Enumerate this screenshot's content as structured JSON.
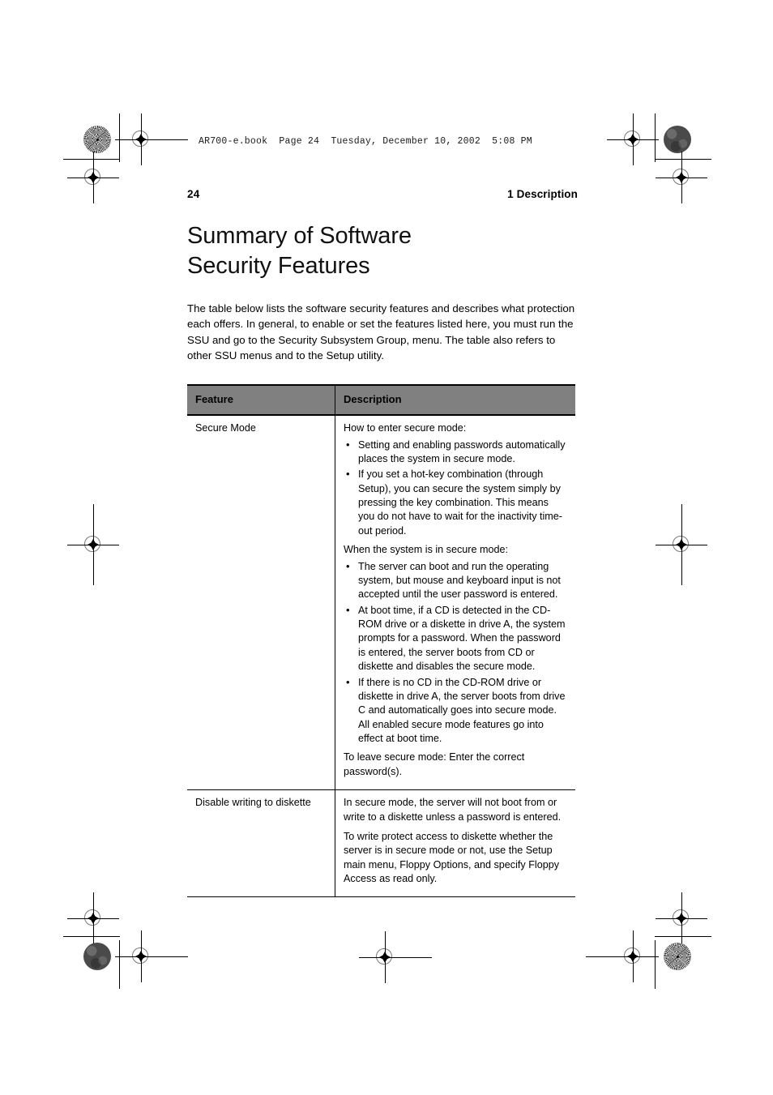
{
  "filestamp": "AR700-e.book  Page 24  Tuesday, December 10, 2002  5:08 PM",
  "page_header": {
    "folio": "24",
    "section": "1 Description"
  },
  "title": {
    "line1": "Summary of Software",
    "line2": "Security Features"
  },
  "intro": "The table below lists the software security features and describes what protection each offers. In general, to enable or set the features listed here, you must run the SSU and go to the Security Subsystem Group, menu. The table also refers to other SSU menus and to the Setup utility.",
  "table": {
    "headers": {
      "feature": "Feature",
      "description": "Description"
    },
    "rows": [
      {
        "feature": "Secure Mode",
        "blocks": [
          {
            "kind": "para",
            "text": "How to enter secure mode:"
          },
          {
            "kind": "list",
            "items": [
              "Setting and enabling passwords automatically places the system in secure mode.",
              "If you set a hot-key combination (through Setup), you can secure the system simply by pressing the key combination. This means you do not have to wait for the inactivity time-out period."
            ]
          },
          {
            "kind": "para",
            "text": "When the system is in secure mode:"
          },
          {
            "kind": "list",
            "items": [
              "The server can boot and run the operating system, but mouse and keyboard input is not accepted until the user password is entered.",
              "At boot time, if a CD is detected in the CD-ROM drive or a diskette in drive A, the system prompts for a password. When the password is entered, the server boots from CD or diskette and disables the secure mode.",
              "If there is no CD in the CD-ROM drive or diskette in drive A, the server boots from drive C and automatically goes into secure mode. All enabled secure mode features go into effect at boot time."
            ]
          },
          {
            "kind": "para",
            "text": "To leave secure mode: Enter the correct password(s)."
          }
        ]
      },
      {
        "feature": "Disable writing to diskette",
        "blocks": [
          {
            "kind": "para",
            "text": "In secure mode, the server will not boot from or write to a diskette unless a password is entered."
          },
          {
            "kind": "para",
            "text": "To write protect access to diskette whether the server is in secure mode or not, use the Setup main menu, Floppy Options, and specify Floppy Access as read only."
          }
        ]
      }
    ]
  },
  "colors": {
    "header_fill": "#808080",
    "rule": "#000000",
    "text": "#000000"
  }
}
